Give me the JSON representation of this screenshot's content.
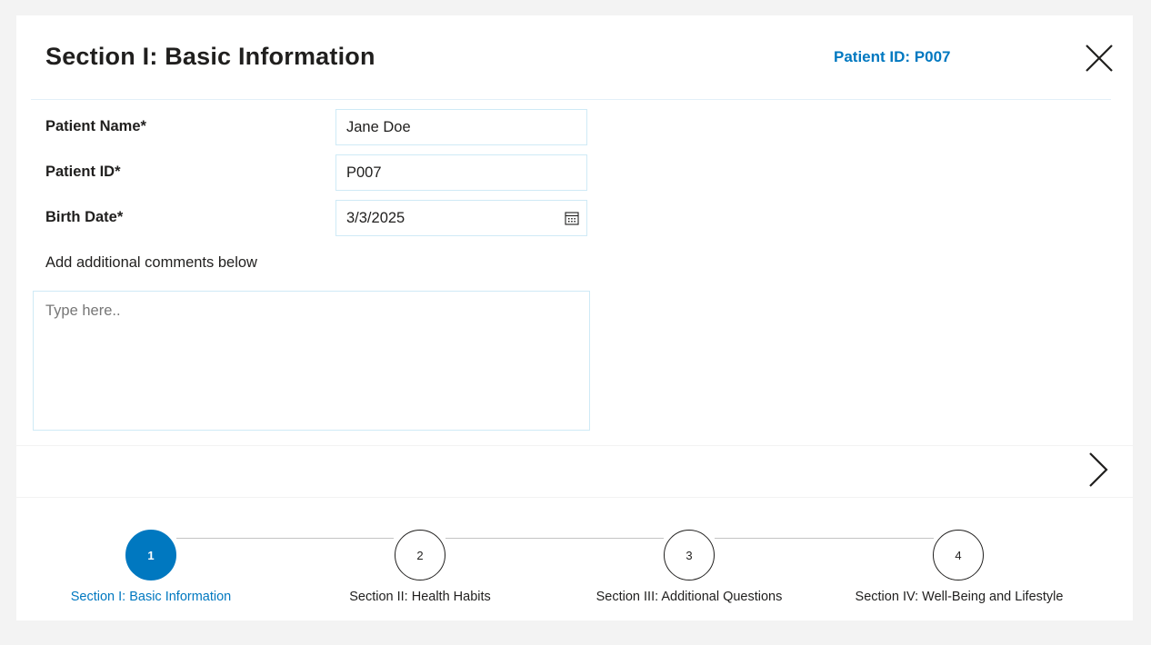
{
  "header": {
    "title": "Section I: Basic Information",
    "patient_id_label": "Patient ID: P007"
  },
  "form": {
    "patient_name": {
      "label": "Patient Name*",
      "value": "Jane Doe"
    },
    "patient_id": {
      "label": "Patient ID*",
      "value": "P007"
    },
    "birth_date": {
      "label": "Birth Date*",
      "value": "3/3/2025"
    },
    "comments": {
      "label": "Add additional comments below",
      "placeholder": "Type here.."
    }
  },
  "stepper": {
    "steps": [
      {
        "number": "1",
        "label": "Section I: Basic Information"
      },
      {
        "number": "2",
        "label": "Section II: Health Habits"
      },
      {
        "number": "3",
        "label": "Section III: Additional Questions"
      },
      {
        "number": "4",
        "label": "Section IV: Well-Being and Lifestyle"
      }
    ],
    "active_index": 0
  },
  "colors": {
    "accent": "#0078c0",
    "input_border": "#cfeaf6",
    "background": "#f3f3f3"
  },
  "icons": [
    "close-icon",
    "calendar-icon",
    "chevron-right-icon"
  ]
}
